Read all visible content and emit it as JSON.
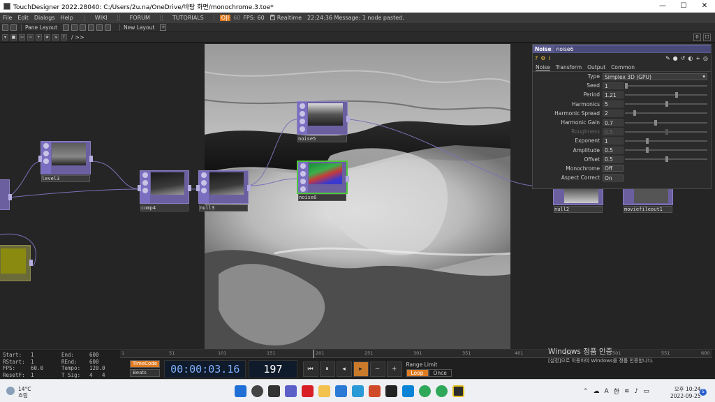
{
  "titlebar": {
    "title": "TouchDesigner 2022.28040: C:/Users/2u.na/OneDrive/바탕 화면/monochrome.3.toe*",
    "minimize": "—",
    "maximize": "☐",
    "close": "✕"
  },
  "menubar": {
    "items": [
      "File",
      "Edit",
      "Dialogs",
      "Help"
    ],
    "nav": [
      "WIKI",
      "FORUM",
      "TUTORIALS"
    ],
    "perf_label": "O|I",
    "fps_target": "60",
    "fps_label": "FPS:",
    "fps_value": "60",
    "realtime_label": "Realtime",
    "message": "22:24:36 Message: 1 node pasted."
  },
  "panebar": {
    "pane_layout": "Pane Layout",
    "new_layout": "New Layout",
    "plus": "+"
  },
  "nettool": {
    "path": "/ >>",
    "right": [
      "0",
      "☐"
    ]
  },
  "nodes": {
    "level3": "level3",
    "comp4": "comp4",
    "null3": "null3",
    "noise5": "noise5",
    "noise6": "noise6",
    "null2": "null2",
    "moviefileout1": "moviefileout1"
  },
  "params": {
    "op_type": "Noise",
    "op_name": "noise6",
    "tabs": [
      "Noise",
      "Transform",
      "Output",
      "Common"
    ],
    "type_label": "Type",
    "type_value": "Simplex 3D (GPU)",
    "rows": [
      {
        "label": "Seed",
        "value": "1"
      },
      {
        "label": "Period",
        "value": "1.21"
      },
      {
        "label": "Harmonics",
        "value": "5"
      },
      {
        "label": "Harmonic Spread",
        "value": "2"
      },
      {
        "label": "Harmonic Gain",
        "value": "0.7"
      },
      {
        "label": "Roughness",
        "value": "0.5"
      },
      {
        "label": "Exponent",
        "value": "1"
      },
      {
        "label": "Amplitude",
        "value": "0.5"
      },
      {
        "label": "Offset",
        "value": "0.5"
      }
    ],
    "monochrome_label": "Monochrome",
    "monochrome_value": "Off",
    "aspect_label": "Aspect Correct",
    "aspect_value": "On"
  },
  "timeline": {
    "info": [
      [
        "Start:",
        "1",
        "End:",
        "600"
      ],
      [
        "RStart:",
        "1",
        "REnd:",
        "600"
      ],
      [
        "FPS:",
        "60.0",
        "Tempo:",
        "120.0"
      ],
      [
        "ResetF:",
        "1",
        "T Sig:",
        "4",
        "4"
      ]
    ],
    "ruler": [
      "1",
      "51",
      "101",
      "151",
      "201",
      "251",
      "301",
      "351",
      "401",
      "451",
      "501",
      "551",
      "600"
    ],
    "timecode_btn": "TimeCode",
    "beats_btn": "Beats",
    "timecode": "00:00:03.16",
    "frame": "197",
    "range_label": "Range Limit",
    "loop": "Loop",
    "once": "Once"
  },
  "watermark": {
    "line1": "Windows 정품 인증",
    "line2": "[설정]으로 이동하여 Windows를 정품 인증합니다."
  },
  "taskbar": {
    "temp": "14°C",
    "weather": "흐림",
    "tray_lang": "A",
    "tray_ime": "한",
    "time": "오후 10:24",
    "date": "2022-09-25",
    "notif_count": "5"
  }
}
